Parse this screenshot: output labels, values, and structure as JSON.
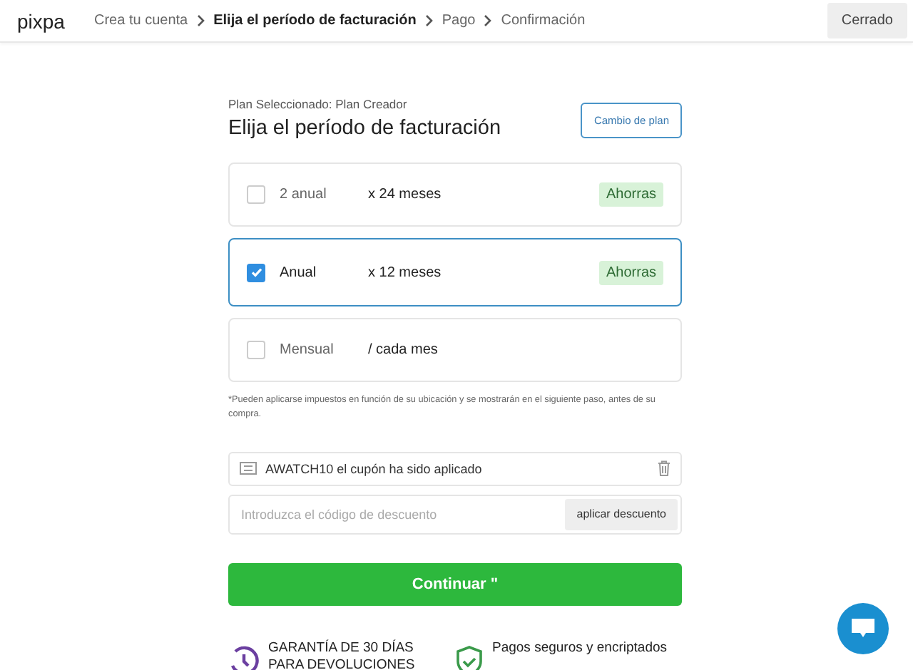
{
  "header": {
    "logo": "pixpa",
    "steps": [
      {
        "label": "Crea tu cuenta",
        "selected": false
      },
      {
        "label": "Elija el período de facturación",
        "selected": true
      },
      {
        "label": "Pago",
        "selected": false
      },
      {
        "label": "Confirmación",
        "selected": false
      }
    ],
    "close_button": "Cerrado"
  },
  "plan_label": "Plan Seleccionado: Plan Creador",
  "title": "Elija el período de facturación",
  "change_plan_button": "Cambio de plan",
  "options": [
    {
      "name": "2 anual",
      "term": "x 24 meses",
      "badge": "Ahorras",
      "selected": false
    },
    {
      "name": "Anual",
      "term": "x 12 meses",
      "badge": "Ahorras",
      "selected": true
    },
    {
      "name": "Mensual",
      "term": "/ cada mes",
      "selected": false
    }
  ],
  "tax_note": "*Pueden aplicarse impuestos en función de su ubicación y se mostrarán en el siguiente paso, antes de su compra.",
  "coupon": {
    "text": "AWATCH10 el cupón ha sido aplicado"
  },
  "discount": {
    "placeholder": "Introduzca el código de descuento",
    "button": "aplicar descuento"
  },
  "continue_button": "Continuar \"",
  "guarantees": [
    {
      "kind": "refund",
      "lines": [
        "GARANTÍA DE 30 DÍAS",
        "PARA DEVOLUCIONES"
      ]
    },
    {
      "kind": "secure",
      "lines": [
        "Pagos seguros y encriptados"
      ]
    }
  ]
}
